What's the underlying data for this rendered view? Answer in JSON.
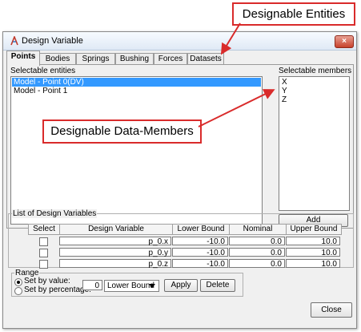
{
  "window": {
    "title": "Design Variable",
    "close_glyph": "×"
  },
  "tabs": [
    {
      "label": "Points",
      "active": true
    },
    {
      "label": "Bodies"
    },
    {
      "label": "Springs"
    },
    {
      "label": "Bushing"
    },
    {
      "label": "Forces"
    },
    {
      "label": "Datasets"
    }
  ],
  "selectable_entities": {
    "label": "Selectable entities",
    "items": [
      {
        "label": "Model - Point 0(DV)",
        "selected": true
      },
      {
        "label": "Model - Point 1"
      }
    ]
  },
  "selectable_members": {
    "label": "Selectable members",
    "items": [
      "X",
      "Y",
      "Z"
    ],
    "add_label": "Add"
  },
  "design_variables": {
    "group_label": "List of Design Variables",
    "columns": {
      "select": "Select",
      "variable": "Design Variable",
      "lower": "Lower Bound",
      "nominal": "Nominal",
      "upper": "Upper Bound"
    },
    "rows": [
      {
        "variable": "p_0.x",
        "lower": "-10.0",
        "nominal": "0.0",
        "upper": "10.0"
      },
      {
        "variable": "p_0.y",
        "lower": "-10.0",
        "nominal": "0.0",
        "upper": "10.0"
      },
      {
        "variable": "p_0.z",
        "lower": "-10.0",
        "nominal": "0.0",
        "upper": "10.0"
      }
    ]
  },
  "range": {
    "group_label": "Range",
    "set_by_value": "Set by value:",
    "set_by_percentage": "Set by percentage:",
    "value": "0",
    "bound_selected": "Lower Bound",
    "apply_label": "Apply",
    "delete_label": "Delete"
  },
  "close_label": "Close",
  "callouts": {
    "designable_entities": "Designable Entities",
    "designable_data_members": "Designable Data-Members"
  },
  "colors": {
    "callout_border": "#d92b2b",
    "selection": "#3399ff"
  }
}
